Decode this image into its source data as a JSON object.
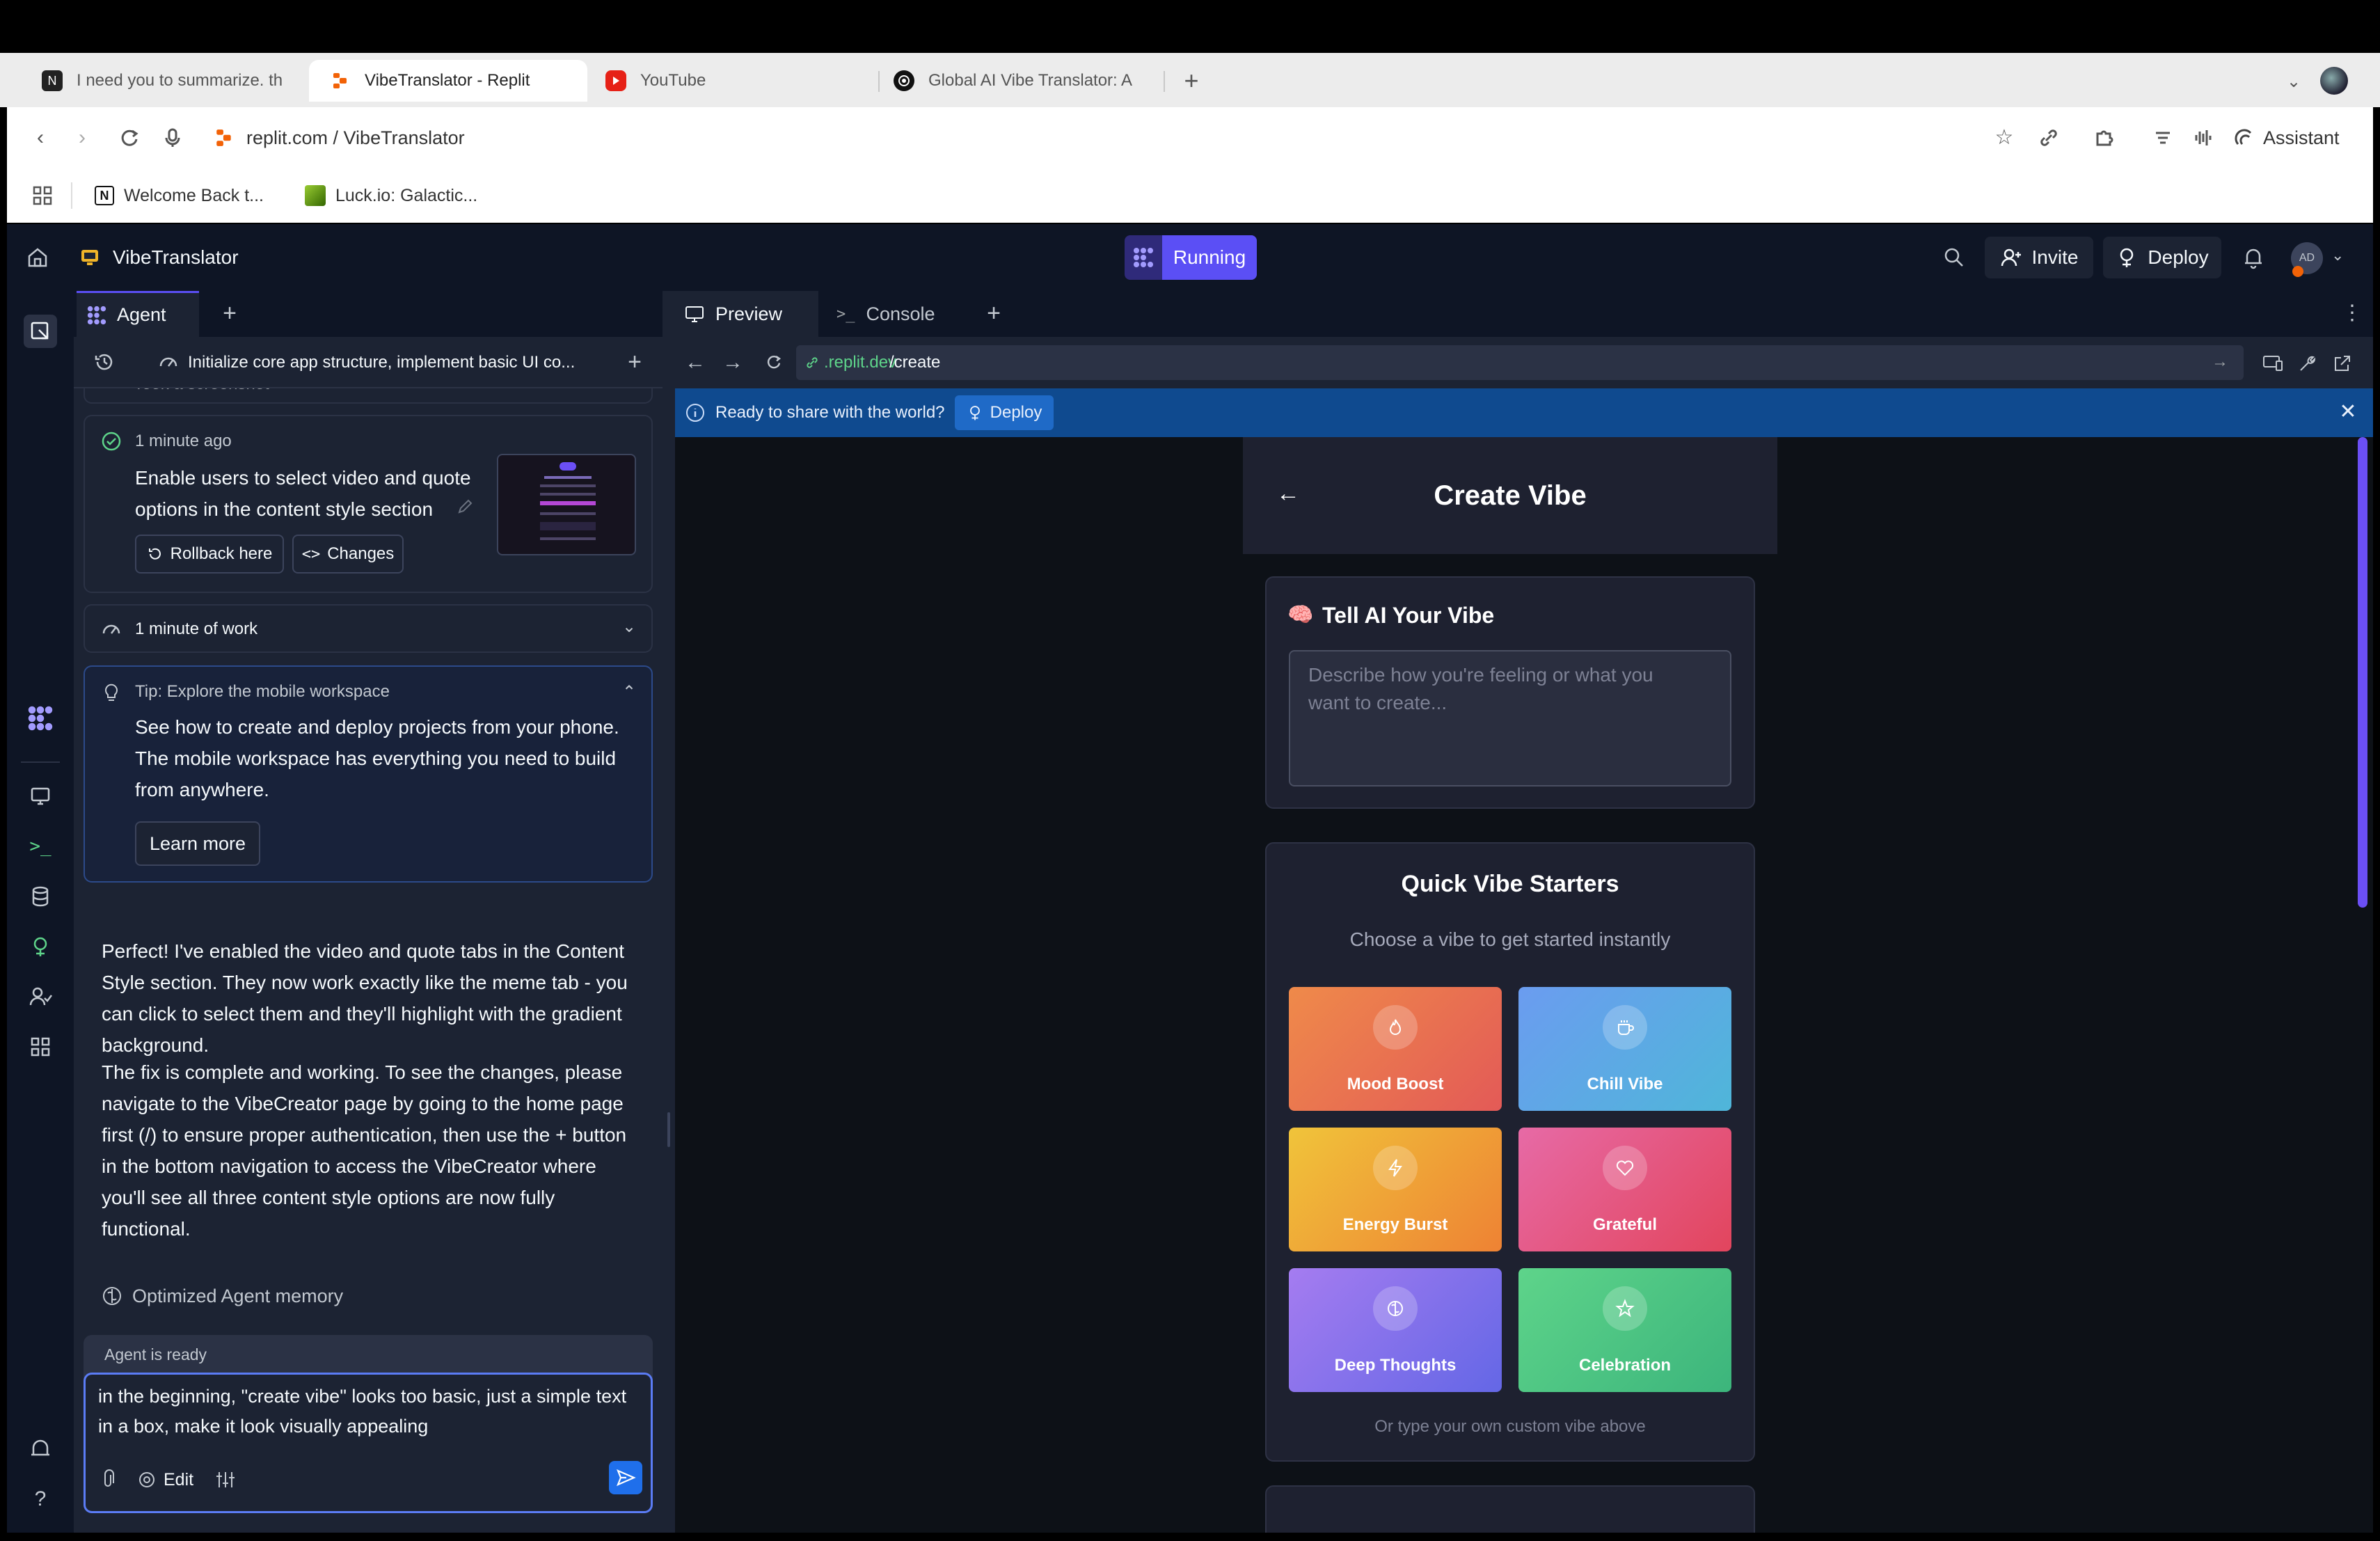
{
  "browser": {
    "tabs": [
      {
        "label": "I need you to summarize. th",
        "icon": "notion-icon"
      },
      {
        "label": "VibeTranslator - Replit",
        "icon": "replit-icon"
      },
      {
        "label": "YouTube",
        "icon": "youtube-icon"
      },
      {
        "label": "Global AI Vibe Translator: A",
        "icon": "openai-icon"
      }
    ],
    "url": "replit.com / VibeTranslator",
    "assistant_label": "Assistant",
    "bookmarks": [
      {
        "label": "Welcome Back t...",
        "icon": "notion-icon"
      },
      {
        "label": "Luck.io: Galactic...",
        "icon": "luck-icon"
      }
    ]
  },
  "app": {
    "project_name": "VibeTranslator",
    "status": "Running",
    "invite_label": "Invite",
    "deploy_label": "Deploy",
    "avatar_initials": "AD",
    "accent": "#5b4ff5"
  },
  "agent": {
    "tab_label": "Agent",
    "history_title": "Initialize core app structure, implement basic UI co...",
    "scrolled_item": "Took a screenshot",
    "checkpoint": {
      "time": "1 minute ago",
      "title": "Enable users to select video and quote options in the content style section",
      "rollback_label": "Rollback here",
      "changes_label": "Changes"
    },
    "work_summary": "1 minute of work",
    "tip": {
      "title": "Tip: Explore the mobile workspace",
      "body": "See how to create and deploy projects from your phone. The mobile workspace has everything you need to build from anywhere.",
      "button": "Learn more"
    },
    "message_p1": "Perfect! I've enabled the video and quote tabs in the Content Style section. They now work exactly like the meme tab - you can click to select them and they'll highlight with the gradient background.",
    "message_p2": "The fix is complete and working. To see the changes, please navigate to the VibeCreator page by going to the home page first (/) to ensure proper authentication, then use the + button in the bottom navigation to access the VibeCreator where you'll see all three content style options are now fully functional.",
    "memory_note": "Optimized Agent memory",
    "ready_status": "Agent is ready",
    "input_value": "in the beginning, \"create vibe\" looks too basic, just a simple text in a box, make it look visually appealing",
    "edit_label": "Edit"
  },
  "preview": {
    "tabs": {
      "preview": "Preview",
      "console": "Console"
    },
    "url_domain": ".replit.dev",
    "url_path": "/create",
    "banner_text": "Ready to share with the world?",
    "banner_deploy": "Deploy",
    "page": {
      "title": "Create Vibe",
      "tell_heading": "Tell AI Your Vibe",
      "tell_emoji": "🧠",
      "textarea_placeholder": "Describe how you're feeling or what you want to create...",
      "starters_heading": "Quick Vibe Starters",
      "starters_sub": "Choose a vibe to get started instantly",
      "vibes": [
        {
          "label": "Mood Boost",
          "icon": "flame-icon",
          "colors": [
            "#ef8a4a",
            "#e35a57"
          ]
        },
        {
          "label": "Chill Vibe",
          "icon": "coffee-icon",
          "colors": [
            "#6b9cf0",
            "#4fb6d9"
          ]
        },
        {
          "label": "Energy Burst",
          "icon": "lightning-icon",
          "colors": [
            "#f0c43a",
            "#ee8234"
          ]
        },
        {
          "label": "Grateful",
          "icon": "heart-icon",
          "colors": [
            "#e76aa6",
            "#e2455d"
          ]
        },
        {
          "label": "Deep Thoughts",
          "icon": "brain-icon",
          "colors": [
            "#a57cf0",
            "#6467e6"
          ]
        },
        {
          "label": "Celebration",
          "icon": "star-icon",
          "colors": [
            "#5ed48a",
            "#3cb57c"
          ]
        }
      ],
      "footer_hint": "Or type your own custom vibe above"
    }
  }
}
